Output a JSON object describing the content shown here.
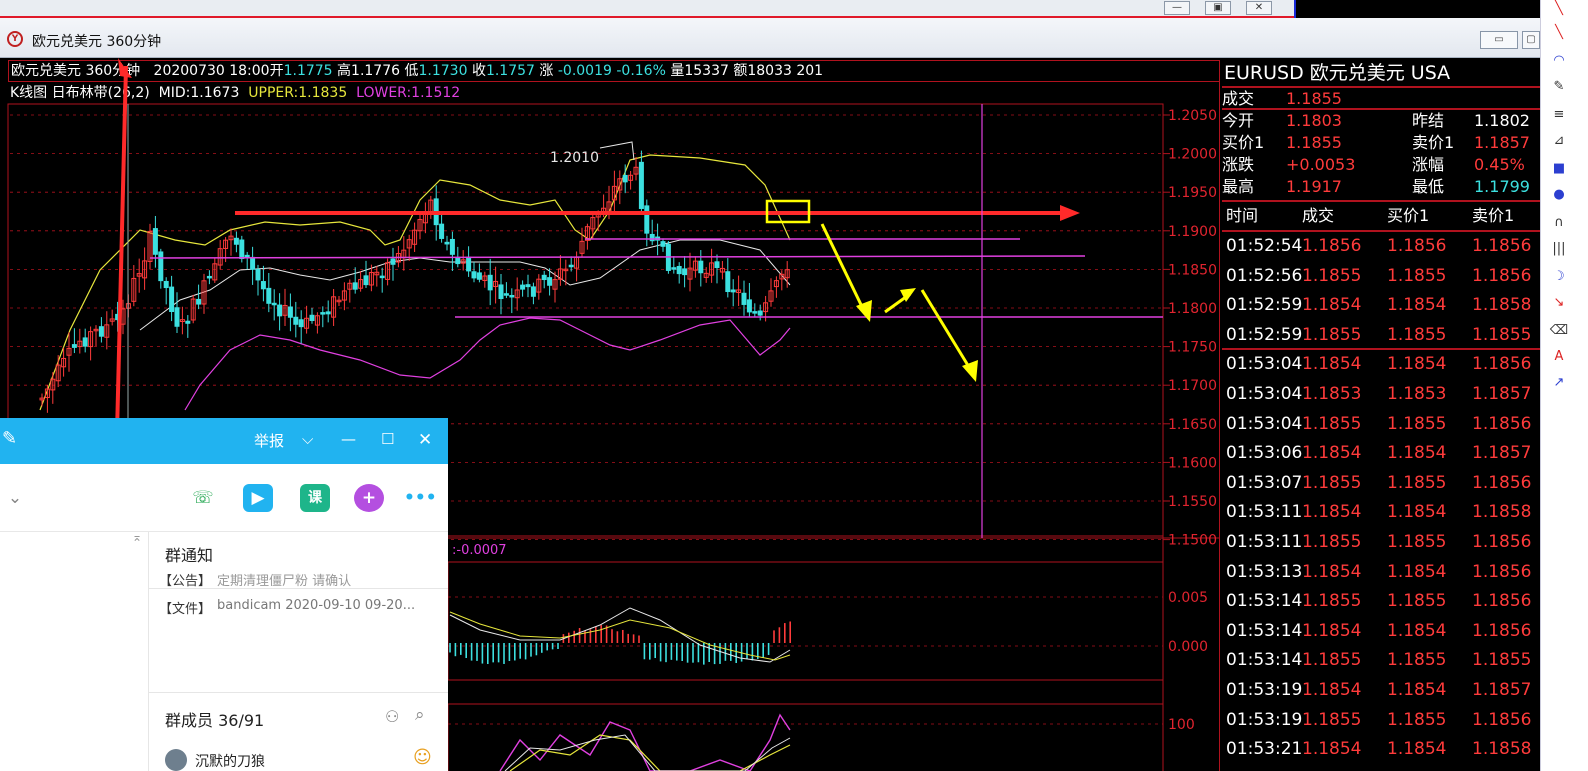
{
  "window": {
    "title": "欧元兑美元 360分钟",
    "logo_glyph": "Y"
  },
  "info_line": {
    "symbol": "欧元兑美元 360分钟",
    "datetime": "20200730 18:00",
    "open_label": "开",
    "open": "1.1775",
    "high_label": "高",
    "high": "1.1776",
    "low_label": "低",
    "low": "1.1730",
    "close_label": "收",
    "close": "1.1757",
    "change_label": "涨",
    "change": "-0.0019",
    "change_pct": "-0.16%",
    "volume_label": "量",
    "volume": "15337",
    "amount_label": "额",
    "amount": "18033",
    "count": "201"
  },
  "indicator_line": {
    "name": "K线图 日布林带",
    "params": "(26,2)",
    "mid": "MID:1.1673",
    "upper": "UPPER:1.1835",
    "lower": "LOWER:1.1512"
  },
  "chart_data": {
    "type": "line",
    "main_axis_labels": [
      "1.2050",
      "1.2000",
      "1.1950",
      "1.1900",
      "1.1850",
      "1.1800",
      "1.1750",
      "1.1700",
      "1.1650",
      "1.1600",
      "1.1550",
      "1.1500"
    ],
    "peak_annotation": "1.2010",
    "macd_label": "-0.0007",
    "macd_axis_labels": [
      "0.005",
      "0.000"
    ],
    "kdj_axis_labels": [
      "100"
    ]
  },
  "quote_panel": {
    "title": "EURUSD  欧元兑美元    USA",
    "trade_label": "成交",
    "trade": "1.1855",
    "open_label": "今开",
    "open": "1.1803",
    "prev_label": "昨结",
    "prev": "1.1802",
    "bid_label": "买价1",
    "bid": "1.1855",
    "ask_label": "卖价1",
    "ask": "1.1857",
    "chg_label": "涨跌",
    "chg": "+0.0053",
    "chgpct_label": "涨幅",
    "chgpct": "0.45%",
    "high_label": "最高",
    "high": "1.1917",
    "low_label": "最低",
    "low": "1.1799"
  },
  "tick_table": {
    "headers": [
      "时间",
      "成交",
      "买价1",
      "卖价1"
    ],
    "rows": [
      [
        "01:52:54",
        "1.1856",
        "1.1856",
        "1.1856"
      ],
      [
        "01:52:56",
        "1.1855",
        "1.1855",
        "1.1856"
      ],
      [
        "01:52:59",
        "1.1854",
        "1.1854",
        "1.1858"
      ],
      [
        "01:52:59",
        "1.1855",
        "1.1855",
        "1.1855"
      ],
      [
        "01:53:04",
        "1.1854",
        "1.1854",
        "1.1856"
      ],
      [
        "01:53:04",
        "1.1853",
        "1.1853",
        "1.1857"
      ],
      [
        "01:53:04",
        "1.1855",
        "1.1855",
        "1.1856"
      ],
      [
        "01:53:06",
        "1.1854",
        "1.1854",
        "1.1857"
      ],
      [
        "01:53:07",
        "1.1855",
        "1.1855",
        "1.1856"
      ],
      [
        "01:53:11",
        "1.1854",
        "1.1854",
        "1.1858"
      ],
      [
        "01:53:11",
        "1.1855",
        "1.1855",
        "1.1856"
      ],
      [
        "01:53:13",
        "1.1854",
        "1.1854",
        "1.1856"
      ],
      [
        "01:53:14",
        "1.1855",
        "1.1855",
        "1.1856"
      ],
      [
        "01:53:14",
        "1.1854",
        "1.1854",
        "1.1856"
      ],
      [
        "01:53:14",
        "1.1855",
        "1.1855",
        "1.1855"
      ],
      [
        "01:53:19",
        "1.1854",
        "1.1854",
        "1.1857"
      ],
      [
        "01:53:19",
        "1.1855",
        "1.1855",
        "1.1856"
      ],
      [
        "01:53:21",
        "1.1854",
        "1.1854",
        "1.1858"
      ]
    ]
  },
  "qq_window": {
    "report": "举报",
    "course_icon": "课",
    "notice_title": "群通知",
    "notice_tag": "【公告】",
    "notice_text": "定期清理僵尸粉 请确认",
    "file_tag": "【文件】",
    "file_text": "bandicam 2020-09-10 09-20...",
    "members_title": "群成员 36/91",
    "member_name": "沉默的刀狼"
  },
  "colors": {
    "up": "#ff3b3b",
    "down": "#3ce0e0",
    "upper_band": "#e6e63c",
    "mid_band": "#e8e8e8",
    "lower_band": "#e040e0",
    "grid": "#b0121e",
    "annotation_red": "#ff2a2a",
    "annotation_yellow": "#ffff00",
    "qq_blue": "#21b3f0"
  }
}
